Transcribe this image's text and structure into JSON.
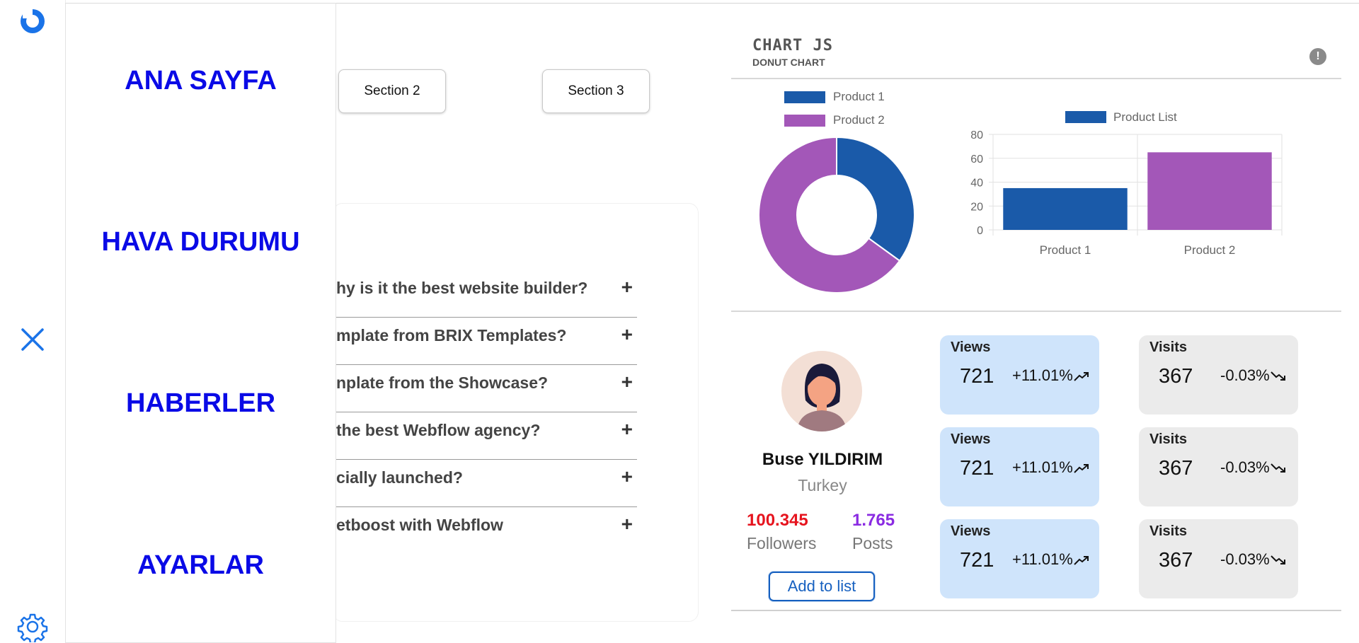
{
  "menu": {
    "items": [
      "ANA SAYFA",
      "HAVA DURUMU",
      "HABERLER",
      "AYARLAR"
    ]
  },
  "sections": {
    "section2": "Section 2",
    "section3": "Section 3"
  },
  "faq": {
    "items": [
      "hy is it the best website builder?",
      "mplate from BRIX Templates?",
      "nplate from the Showcase?",
      " the best Webflow agency?",
      "cially launched?",
      "etboost with Webflow"
    ],
    "expand_symbol": "+"
  },
  "chart_card": {
    "title": "CHART JS",
    "subtitle": "DONUT CHART",
    "info_symbol": "!"
  },
  "chart_data": [
    {
      "type": "pie",
      "variant": "donut",
      "categories": [
        "Product 1",
        "Product 2"
      ],
      "values": [
        35,
        65
      ],
      "colors": [
        "#1a5aa9",
        "#a357b8"
      ],
      "legend": "top"
    },
    {
      "type": "bar",
      "categories": [
        "Product 1",
        "Product 2"
      ],
      "series": [
        {
          "name": "Product List",
          "values": [
            35,
            65
          ]
        }
      ],
      "colors": [
        "#1a5aa9",
        "#a357b8"
      ],
      "ylim": [
        0,
        80
      ],
      "yticks": [
        "0",
        "20",
        "40",
        "60",
        "80"
      ],
      "grid": true,
      "legend": "top"
    }
  ],
  "profile": {
    "name": "Buse YILDIRIM",
    "country": "Turkey",
    "followers_value": "100.345",
    "followers_label": "Followers",
    "posts_value": "1.765",
    "posts_label": "Posts",
    "add_button": "Add to list"
  },
  "stats": {
    "views": [
      {
        "label": "Views",
        "value": "721",
        "change": "+11.01%"
      },
      {
        "label": "Views",
        "value": "721",
        "change": "+11.01%"
      },
      {
        "label": "Views",
        "value": "721",
        "change": "+11.01%"
      }
    ],
    "visits": [
      {
        "label": "Visits",
        "value": "367",
        "change": "-0.03%"
      },
      {
        "label": "Visits",
        "value": "367",
        "change": "-0.03%"
      },
      {
        "label": "Visits",
        "value": "367",
        "change": "-0.03%"
      }
    ]
  },
  "colors": {
    "menu_text": "#0a0ae6",
    "accent": "#1a73e8",
    "followers": "#e6141e",
    "posts": "#8a2be2"
  },
  "icons": {
    "logo": "logo-icon",
    "close": "close-icon",
    "settings": "gear-icon",
    "info": "info-icon",
    "trend_up": "trend-up-icon",
    "trend_down": "trend-down-icon"
  }
}
